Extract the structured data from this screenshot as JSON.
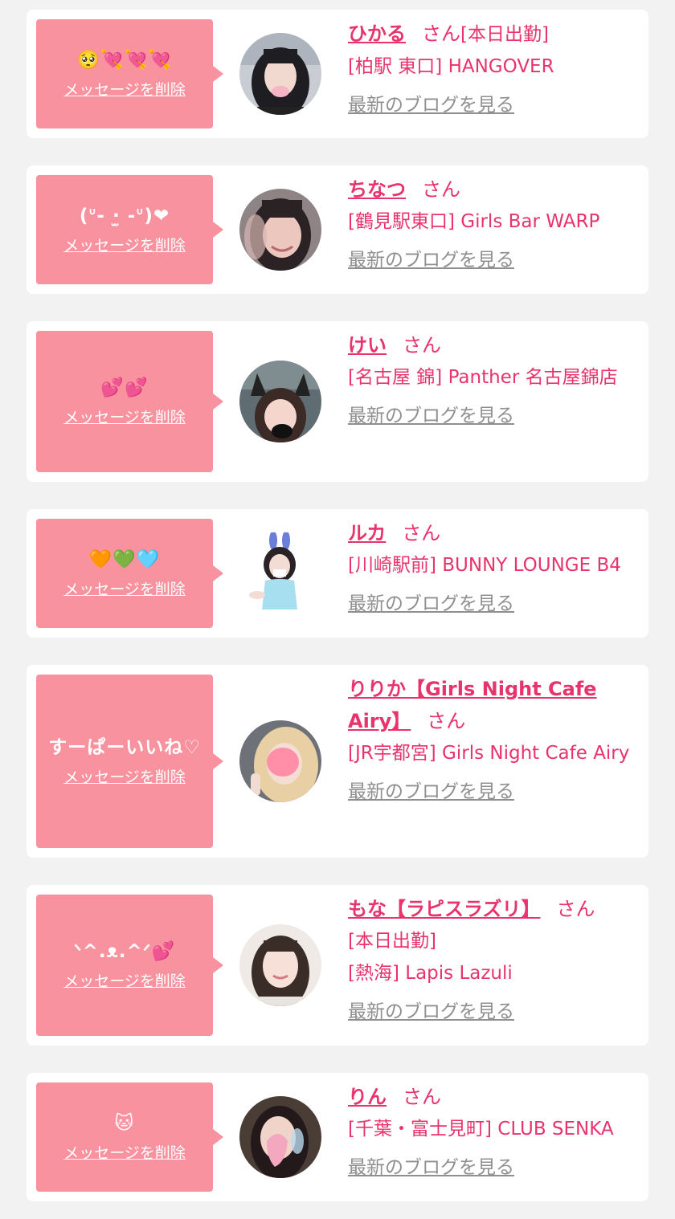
{
  "delete_label": "メッセージを削除",
  "blog_label": "最新のブログを見る",
  "san_label": "さん",
  "colors": {
    "accent": "#e8336d",
    "bubble": "#f9929f",
    "background": "#f2f2f2",
    "blog_link": "#8f8f8f"
  },
  "items": [
    {
      "message": "🥺💘💘💘",
      "name": "ひかる",
      "status": "[本日出勤]",
      "shop": "[柏駅 東口] HANGOVER"
    },
    {
      "message": "(ᐡ- ·̫ -ᐡ)❤",
      "name": "ちなつ",
      "shop": "[鶴見駅東口] Girls Bar WARP"
    },
    {
      "message": "💕💕",
      "name": "けい",
      "shop": "[名古屋 錦] Panther 名古屋錦店"
    },
    {
      "message": "🧡💚🩵",
      "name": "ルカ",
      "shop": "[川崎駅前] BUNNY LOUNGE B4"
    },
    {
      "message": "すーぱーいいね♡",
      "name": "りりか【Girls Night Cafe Airy】",
      "shop": "[JR宇都宮] Girls Night Cafe Airy"
    },
    {
      "message": "ᐠ^.ᴥ.^ᐟ💕",
      "name": "もな【ラピスラズリ】",
      "status": "[本日出勤]",
      "shop": "[熱海] Lapis Lazuli"
    },
    {
      "message": "🐱",
      "name": "りん",
      "shop": "[千葉・富士見町] CLUB SENKA"
    }
  ]
}
